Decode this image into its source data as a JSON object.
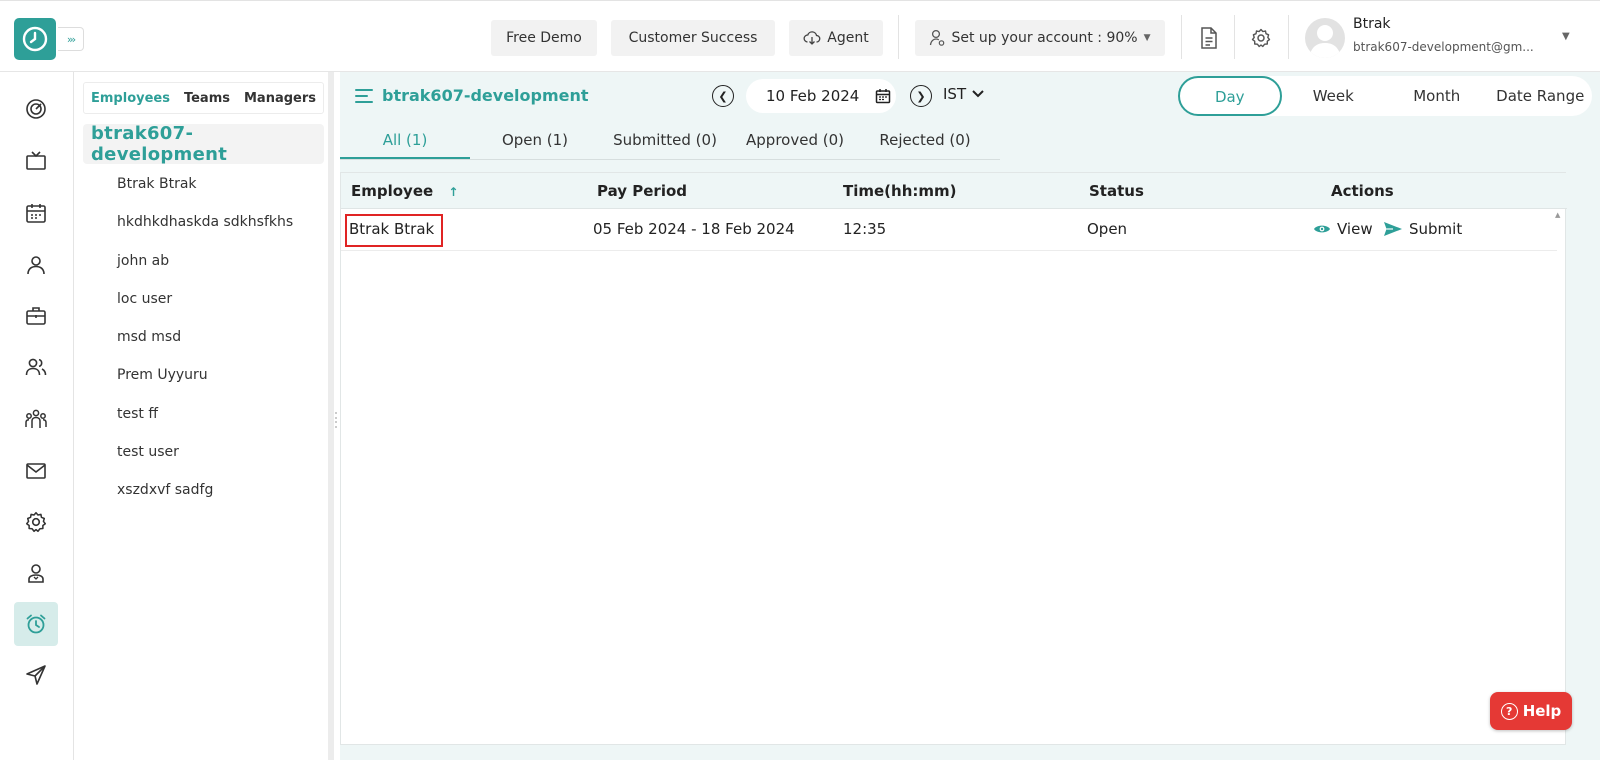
{
  "header": {
    "free_demo": "Free Demo",
    "customer_success": "Customer Success",
    "agent": "Agent",
    "setup": "Set up your account : 90%",
    "user_name": "Btrak",
    "user_email": "btrak607-development@gm..."
  },
  "rail": {
    "icons": [
      "dashboard-icon",
      "tv-icon",
      "calendar-icon",
      "user-icon",
      "briefcase-icon",
      "users-icon",
      "team-icon",
      "mail-icon",
      "settings-icon",
      "profile-icon",
      "alarm-clock-icon",
      "send-icon"
    ],
    "active": "alarm-clock-icon"
  },
  "directory": {
    "tabs": [
      "Employees",
      "Teams",
      "Managers"
    ],
    "active_tab": "Employees",
    "group": "btrak607-development",
    "employees": [
      "Btrak Btrak",
      "hkdhkdhaskda sdkhsfkhs",
      "john ab",
      "loc user",
      "msd msd",
      "Prem Uyyuru",
      "test ff",
      "test user",
      "xszdxvf sadfg"
    ]
  },
  "main": {
    "title": "btrak607-development",
    "date": "10 Feb 2024",
    "timezone": "IST",
    "ranges": [
      "Day",
      "Week",
      "Month",
      "Date Range"
    ],
    "active_range": "Day",
    "tabs": [
      "All (1)",
      "Open (1)",
      "Submitted (0)",
      "Approved (0)",
      "Rejected (0)"
    ],
    "active_tab": "All (1)"
  },
  "table": {
    "columns": [
      "Employee",
      "Pay Period",
      "Time(hh:mm)",
      "Status",
      "Actions"
    ],
    "rows": [
      {
        "employee": "Btrak Btrak",
        "pay_period": "05 Feb 2024 - 18 Feb 2024",
        "time": "12:35",
        "status": "Open",
        "view": "View",
        "submit": "Submit"
      }
    ]
  },
  "help": "Help",
  "colors": {
    "accent": "#2e9f98",
    "highlight": "#e02424",
    "help": "#e53935"
  }
}
